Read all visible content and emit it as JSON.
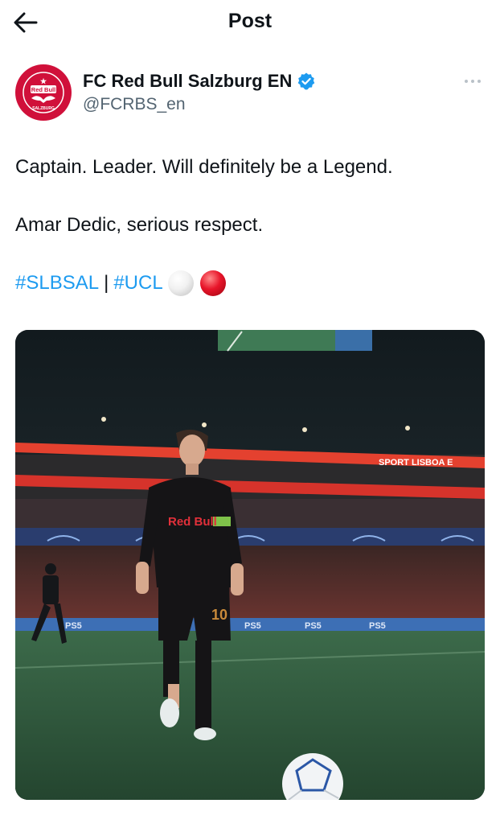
{
  "header": {
    "title": "Post",
    "back_icon": "arrow-left-icon"
  },
  "author": {
    "display_name": "FC Red Bull Salzburg EN",
    "handle": "@FCRBS_en",
    "verified_icon": "verified-badge-icon",
    "avatar_logo_text": "Red Bull",
    "avatar_logo_subtext": "SALZBURG",
    "avatar_color": "#d0103a",
    "verified_color": "#1d9bf0"
  },
  "tweet": {
    "line1": "Captain. Leader. Will definitely be a Legend.",
    "line2": "Amar Dedic, serious respect.",
    "hashtag1": "#SLBSAL",
    "separator": "|",
    "hashtag2": "#UCL",
    "emojis": [
      "white-circle-emoji",
      "red-circle-emoji"
    ],
    "link_color": "#1d9bf0"
  },
  "media": {
    "kind": "photo",
    "jersey_text": "Red Bull",
    "jersey_number": "10",
    "stadium_board_text": "SPORT LISBOA E",
    "ad_board_text": "PS5"
  }
}
